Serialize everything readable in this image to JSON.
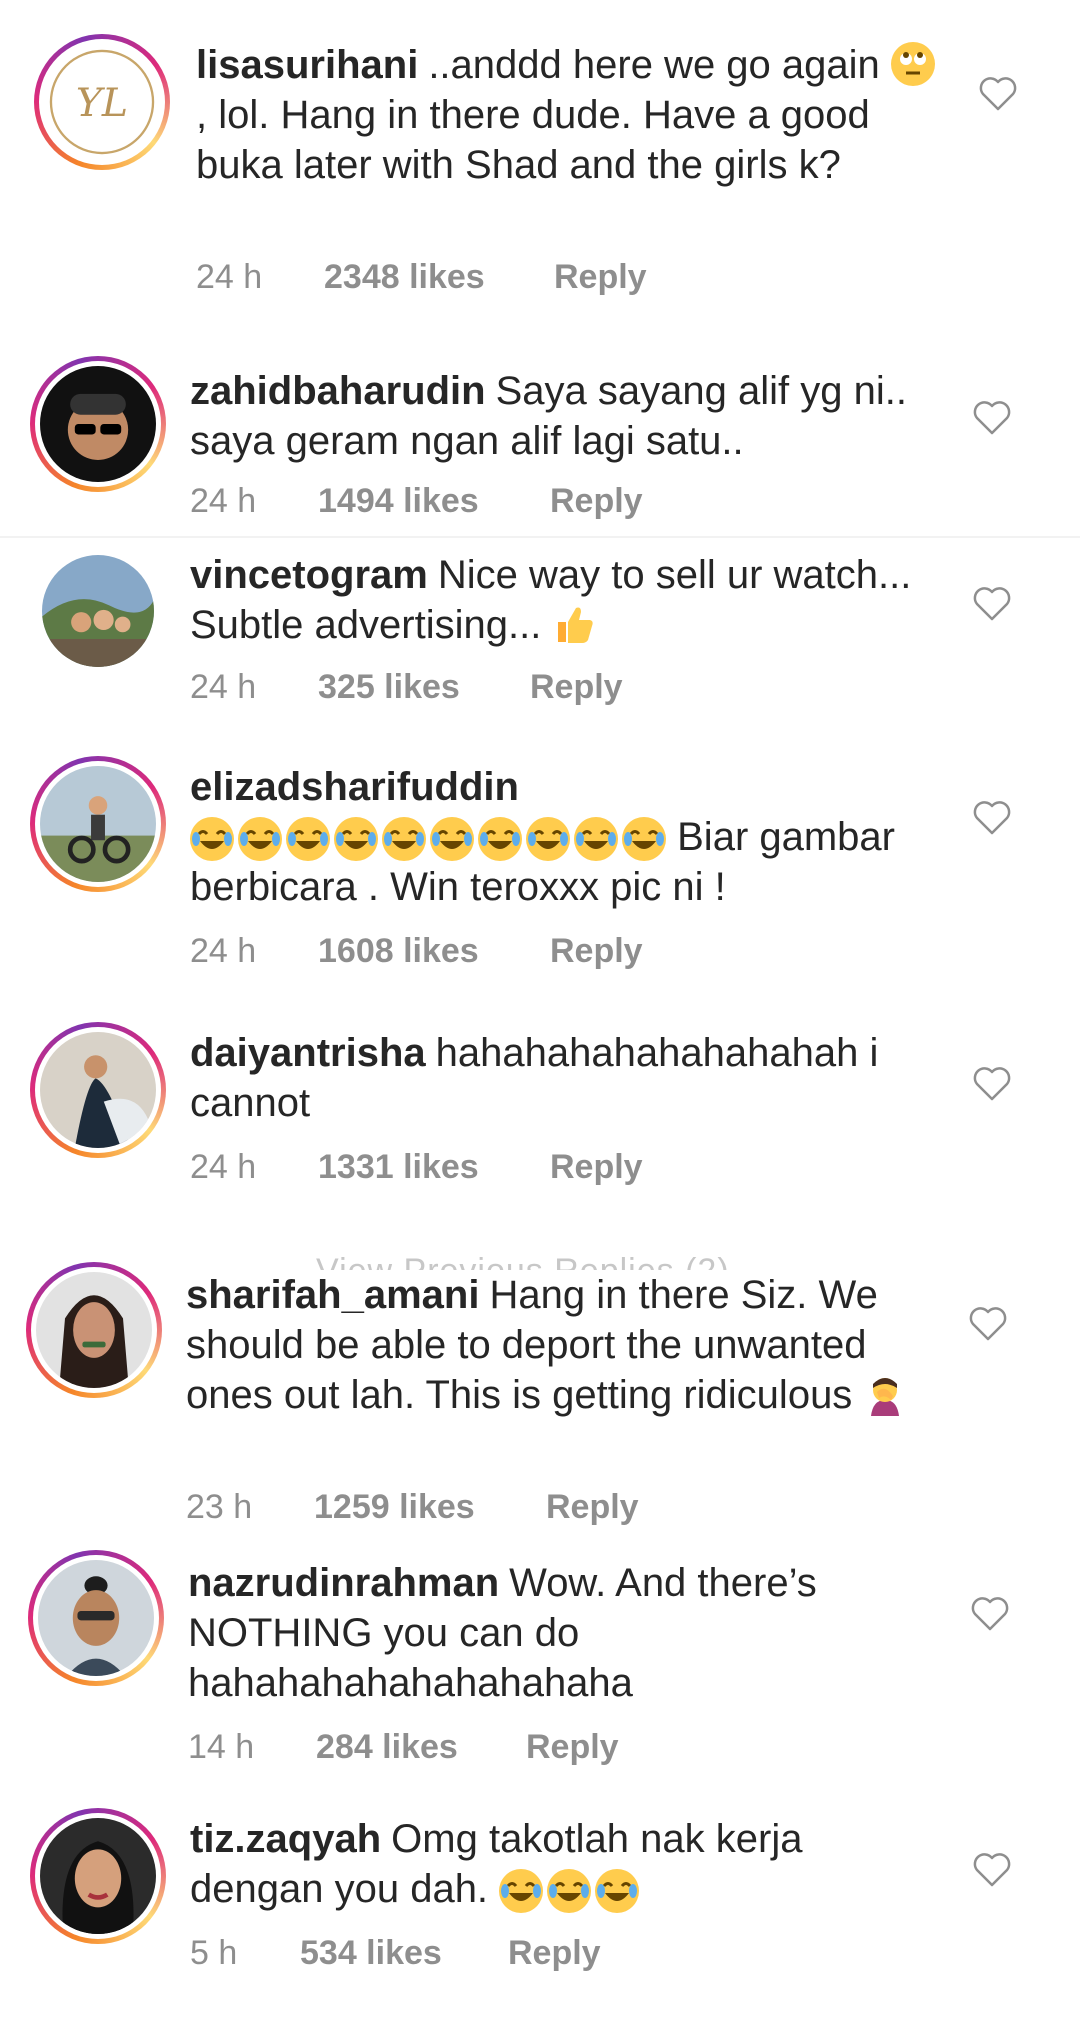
{
  "comments": [
    {
      "username": "lisasurihani",
      "text_parts": [
        "..anddd here we go again ",
        " , lol. Hang in there dude. Have a good buka later with Shad and the girls k?"
      ],
      "emoji": "eye-roll",
      "time": "24 h",
      "likes": "2348 likes",
      "reply": "Reply"
    },
    {
      "username": "zahidbaharudin",
      "text": "Saya sayang alif yg ni.. saya geram ngan alif lagi satu..",
      "time": "24 h",
      "likes": "1494 likes",
      "reply": "Reply"
    },
    {
      "username": "vincetogram",
      "text": "Nice way to sell ur watch... Subtle advertising...",
      "emoji": "thumbs-up",
      "time": "24 h",
      "likes": "325 likes",
      "reply": "Reply"
    },
    {
      "username": "elizadsharifuddin",
      "text": "Biar gambar berbicara . Win teroxxx pic ni !",
      "emoji": "tears-of-joy",
      "time": "24 h",
      "likes": "1608 likes",
      "reply": "Reply"
    },
    {
      "username": "daiyantrisha",
      "text": "hahahahahahahahahah i cannot",
      "time": "24 h",
      "likes": "1331 likes",
      "reply": "Reply"
    },
    {
      "username": "sharifah_amani",
      "text": "Hang in there Siz. We should be able to deport the unwanted ones out lah. This is getting ridiculous",
      "emoji": "facepalm",
      "time": "23 h",
      "likes": "1259 likes",
      "reply": "Reply"
    },
    {
      "username": "nazrudinrahman",
      "text": "Wow. And there’s NOTHING you can do hahahahahahahahahaha",
      "time": "14 h",
      "likes": "284 likes",
      "reply": "Reply"
    },
    {
      "username": "tiz.zaqyah",
      "text": "Omg takotlah nak kerja dengan you dah.",
      "emoji": "rofl",
      "time": "5 h",
      "likes": "534 likes",
      "reply": "Reply"
    }
  ],
  "hidden_text": "View Previous Replies (2)",
  "colors": {
    "text": "#262626",
    "meta": "#8e8e8e",
    "ring_start": "#f58529",
    "ring_mid": "#dd2a7b",
    "ring_end": "#8134af",
    "emoji": "#ffcc4d"
  }
}
